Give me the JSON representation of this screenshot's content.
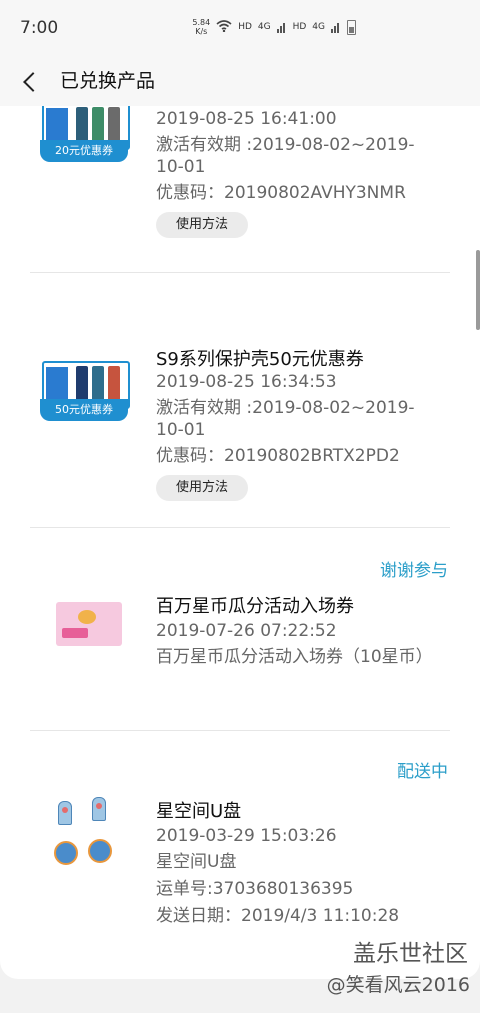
{
  "status_bar": {
    "time": "7:00",
    "net_speed_value": "5.84",
    "net_speed_unit": "K/s",
    "hd1": "HD",
    "hd2": "HD",
    "lte1": "4G",
    "lte2": "4G"
  },
  "header": {
    "title": "已兑换产品"
  },
  "items": [
    {
      "name": "",
      "date": "2019-08-25 16:41:00",
      "validity": "激活有效期 :2019-08-02~2019-10-01",
      "code": "优惠码：20190802AVHY3NMR",
      "usage_label": "使用方法",
      "coupon_text": "20元优惠券"
    },
    {
      "name": "S9系列保护壳50元优惠券",
      "date": "2019-08-25 16:34:53",
      "validity": "激活有效期 :2019-08-02~2019-10-01",
      "code": "优惠码：20190802BRTX2PD2",
      "usage_label": "使用方法",
      "coupon_text": "50元优惠券"
    },
    {
      "status": "谢谢参与",
      "name": "百万星币瓜分活动入场券",
      "date": "2019-07-26 07:22:52",
      "desc": "百万星币瓜分活动入场券（10星币）"
    },
    {
      "status": "配送中",
      "name": "星空间U盘",
      "date": "2019-03-29 15:03:26",
      "desc": "星空间U盘",
      "tracking": "运单号:3703680136395",
      "ship_date": "发送日期：2019/4/3 11:10:28"
    }
  ],
  "watermark": {
    "line1": "盖乐世社区",
    "line2": "@笑看风云2016"
  },
  "colors": {
    "accent": "#2b9ec9",
    "coupon_blue": "#1f8fd0"
  }
}
